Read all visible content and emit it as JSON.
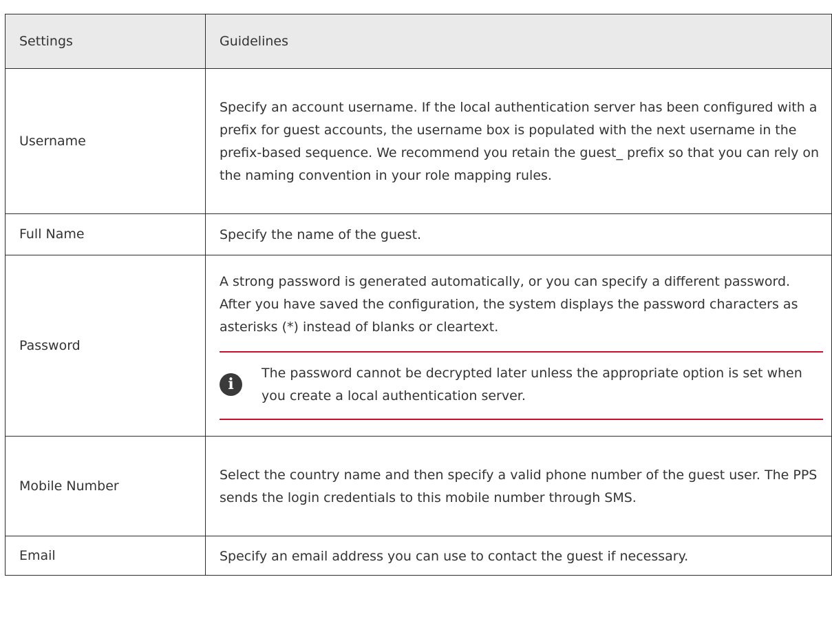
{
  "table": {
    "headers": {
      "settings": "Settings",
      "guidelines": "Guidelines"
    },
    "rows": [
      {
        "setting": "Username",
        "guideline": "Specify an account username. If the local authentication server has been configured with a prefix for guest accounts, the username box is populated with the next username in the prefix-based sequence. We recommend you retain the guest_ prefix so that you can rely on the naming convention in your role mapping rules."
      },
      {
        "setting": "Full Name",
        "guideline": "Specify the name of the guest."
      },
      {
        "setting": "Password",
        "guideline": "A strong password is generated automatically, or you can specify a different password. After you have saved the configuration, the system displays the password characters as asterisks (*) instead of blanks or cleartext.",
        "note": {
          "icon": "info-icon",
          "icon_glyph": "i",
          "text": "The password cannot be decrypted later unless the appropriate option is set when you create a local authentication server."
        }
      },
      {
        "setting": "Mobile Number",
        "guideline": "Select the country name and then specify a valid phone number of the guest user. The PPS sends the login credentials to this mobile number through SMS."
      },
      {
        "setting": "Email",
        "guideline": "Specify an email address you can use to contact the guest if necessary."
      }
    ]
  },
  "colors": {
    "header_bg": "#eaeaea",
    "border": "#2b2b2b",
    "note_rule": "#c8102e",
    "text": "#333333",
    "icon_bg": "#3a3a3a"
  }
}
